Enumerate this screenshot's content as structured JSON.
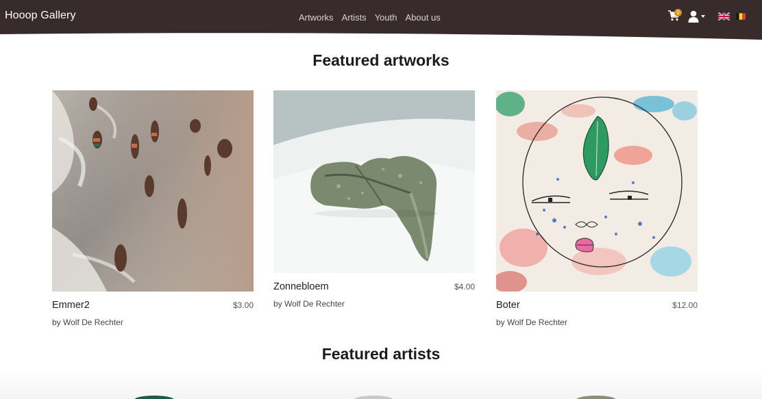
{
  "navbar": {
    "brand": "Hooop Gallery",
    "links": [
      "Artworks",
      "Artists",
      "Youth",
      "About us"
    ],
    "cart_count": "0",
    "icons": [
      "cart-icon",
      "user-icon",
      "flag-uk-icon",
      "flag-belgium-icon"
    ],
    "background_color": "#372b2b"
  },
  "featured_artworks": {
    "heading": "Featured artworks",
    "items": [
      {
        "title": "Emmer2",
        "price": "$3.00",
        "artist": "by Wolf De Rechter"
      },
      {
        "title": "Zonnebloem",
        "price": "$4.00",
        "artist": "by Wolf De Rechter"
      },
      {
        "title": "Boter",
        "price": "$12.00",
        "artist": "by Wolf De Rechter"
      }
    ]
  },
  "featured_artists": {
    "heading": "Featured artists"
  }
}
